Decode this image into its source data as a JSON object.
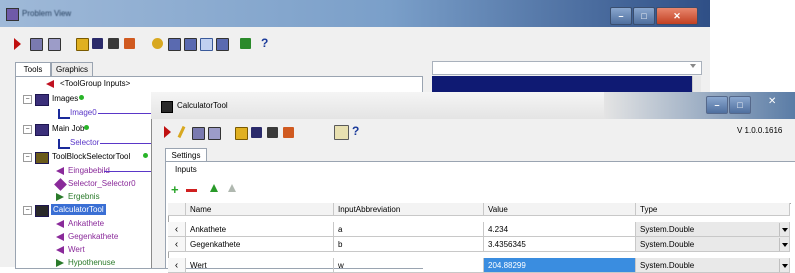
{
  "main_window": {
    "title": "Problem View",
    "tabs": [
      "Tools",
      "Graphics"
    ]
  },
  "tree": {
    "items": [
      {
        "label": "<ToolGroup Inputs>",
        "color": "#1a1a1a"
      },
      {
        "label": "Images",
        "color": "#1a1a1a"
      },
      {
        "label": "Image0",
        "color": "#5a37c8"
      },
      {
        "label": "Main Job",
        "color": "#1a1a1a"
      },
      {
        "label": "Selector",
        "color": "#5a37c8"
      },
      {
        "label": "ToolBlockSelectorTool",
        "color": "#1a1a1a"
      },
      {
        "label": "Eingabebild",
        "color": "#8a2a9a"
      },
      {
        "label": "Selector_Selector0",
        "color": "#8a2a9a"
      },
      {
        "label": "Ergebnis",
        "color": "#2a7a2a"
      },
      {
        "label": "CalculatorTool",
        "color": "#ffffff"
      },
      {
        "label": "Ankathete",
        "color": "#8a2a9a"
      },
      {
        "label": "Gegenkathete",
        "color": "#8a2a9a"
      },
      {
        "label": "Wert",
        "color": "#8a2a9a"
      },
      {
        "label": "Hypothenuse",
        "color": "#2a7a2a"
      }
    ]
  },
  "calculator": {
    "title": "CalculatorTool",
    "version": "V 1.0.0.1616",
    "settings_tab": "Settings",
    "inputs_label": "Inputs",
    "columns": [
      "Name",
      "InputAbbreviation",
      "Value",
      "Type"
    ],
    "rows": [
      {
        "name": "Ankathete",
        "abbr": "a",
        "value": "4.234",
        "type": "System.Double"
      },
      {
        "name": "Gegenkathete",
        "abbr": "b",
        "value": "3.4356345",
        "type": "System.Double"
      },
      {
        "name": "Wert",
        "abbr": "w",
        "value": "204.88299",
        "type": "System.Double"
      }
    ],
    "selected_value_color": "#3a8de0"
  },
  "colors": {
    "dark_panel": "#0f1a73",
    "tree_selected": "#3a6fd4",
    "add_green": "#2aa52a",
    "remove_red": "#d02020"
  }
}
